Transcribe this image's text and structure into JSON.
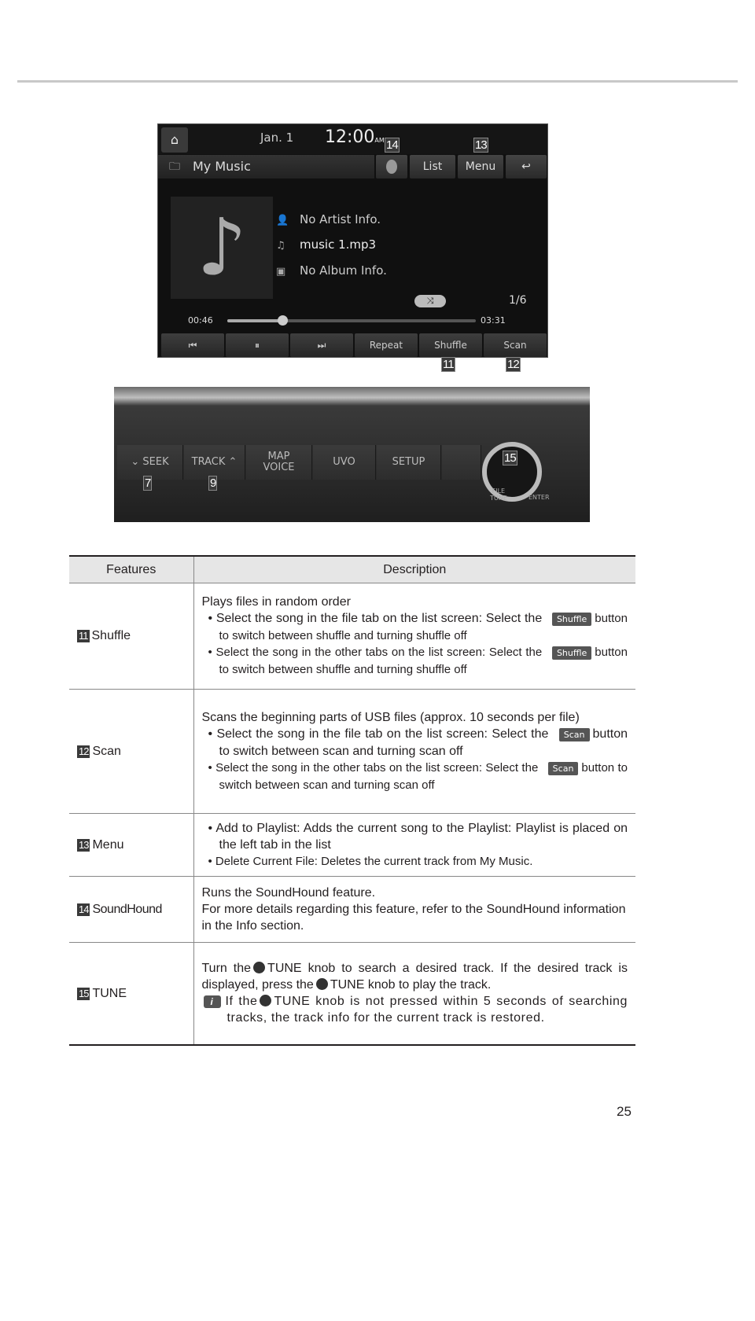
{
  "screen": {
    "date": "Jan. 1",
    "time": "12:00",
    "ampm": "AM",
    "title": "My Music",
    "top_buttons": {
      "list": "List",
      "menu": "Menu"
    },
    "artist": "No Artist Info.",
    "track": "music 1.mp3",
    "album": "No Album Info.",
    "track_count": "1/6",
    "elapsed": "00:46",
    "duration": "03:31",
    "progress_percent": 22,
    "bottom_buttons": {
      "repeat": "Repeat",
      "shuffle": "Shuffle",
      "scan": "Scan"
    },
    "callouts": {
      "c14": "14",
      "c13": "13",
      "c11": "11",
      "c12": "12"
    }
  },
  "panel": {
    "buttons": {
      "seek": "SEEK",
      "track": "TRACK",
      "map": "MAP",
      "voice": "VOICE",
      "uvo": "UVO",
      "setup": "SETUP"
    },
    "file_label": "FILE",
    "tune_label": "TUNE",
    "enter_label": "ENTER",
    "callouts": {
      "c7": "7",
      "c9": "9",
      "c15": "15"
    }
  },
  "table": {
    "headers": {
      "features": "Features",
      "description": "Description"
    },
    "rows": [
      {
        "num": "11",
        "feature": "Shuffle",
        "intro": "Plays files in random order",
        "b1a": "Select the song in the file tab on the list screen: Select the",
        "b1btn": "Shuffle",
        "b1b": "button to switch between shuffle and turning shuffle off",
        "b2a": "Select the song in the other tabs on the list screen: Select the",
        "b2btn": "Shuffle",
        "b2b": "button to switch between shuffle and turning shuffle off"
      },
      {
        "num": "12",
        "feature": "Scan",
        "intro": "Scans the beginning parts of USB files (approx. 10 seconds per file)",
        "b1a": "Select the song in the file tab on the list screen: Select the",
        "b1btn": "Scan",
        "b1b": "button to switch between scan and turning scan off",
        "b2a": "Select the song in the other tabs on the list screen: Select the",
        "b2btn": "Scan",
        "b2b": "button to switch between scan and turning scan off"
      },
      {
        "num": "13",
        "feature": "Menu",
        "b1": "Add to Playlist: Adds the current song to the Playlist: Playlist is placed on the left tab in the list",
        "b2": "Delete Current File: Deletes the current track from My Music."
      },
      {
        "num": "14",
        "feature": "SoundHound",
        "l1": "Runs the SoundHound feature.",
        "l2": "For more details regarding this feature, refer to the SoundHound information in the Info section."
      },
      {
        "num": "15",
        "feature": "TUNE",
        "p1a": "Turn the",
        "p1k": "TUNE",
        "p1b": "knob to search a desired track. If the desired track is displayed, press the",
        "p1k2": "TUNE",
        "p1c": "knob to play the track.",
        "n1": "If the",
        "nk": "TUNE",
        "n2": "knob is not pressed within 5 seconds of searching tracks, the track info for the current track is restored."
      }
    ]
  },
  "page_number": "25"
}
